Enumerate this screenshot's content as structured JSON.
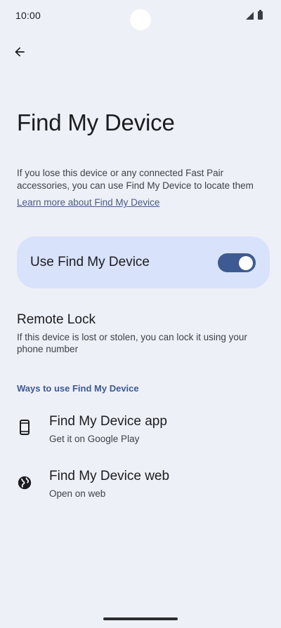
{
  "status_bar": {
    "time": "10:00"
  },
  "header": {
    "back_icon": "arrow-back-icon"
  },
  "page": {
    "title": "Find My Device",
    "description": "If you lose this device or any connected Fast Pair accessories, you can use Find My Device to locate them",
    "learn_more_link": "Learn more about Find My Device"
  },
  "main_toggle": {
    "label": "Use Find My Device",
    "enabled": true,
    "accent_color": "#3d5a92",
    "card_color": "#d8e2fb"
  },
  "remote_lock": {
    "title": "Remote Lock",
    "subtitle": "If this device is lost or stolen, you can lock it using your phone number"
  },
  "ways_section": {
    "header": "Ways to use Find My Device",
    "items": [
      {
        "icon": "phone-icon",
        "title": "Find My Device app",
        "subtitle": "Get it on Google Play"
      },
      {
        "icon": "globe-icon",
        "title": "Find My Device web",
        "subtitle": "Open on web"
      }
    ]
  }
}
